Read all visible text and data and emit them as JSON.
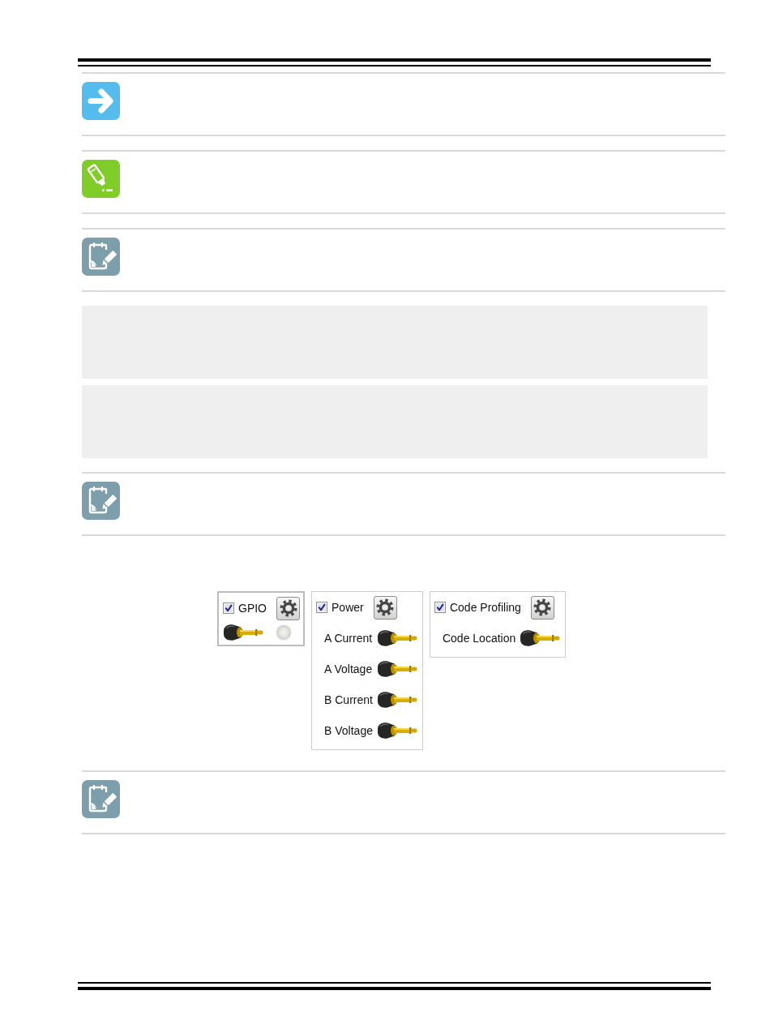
{
  "page": {
    "blocks": [
      {
        "kind": "tip"
      },
      {
        "kind": "important"
      },
      {
        "kind": "note"
      },
      {
        "kind": "code"
      },
      {
        "kind": "code"
      },
      {
        "kind": "note"
      },
      {
        "kind": "figure",
        "panels": [
          {
            "title": "GPIO",
            "checked": true,
            "selected": true,
            "channels": [
              {
                "kind": "probe"
              },
              {
                "kind": "led",
                "on": false
              }
            ]
          },
          {
            "title": "Power",
            "checked": true,
            "selected": false,
            "channels": [
              {
                "kind": "labeled-probe",
                "label": "A Current"
              },
              {
                "kind": "labeled-probe",
                "label": "A Voltage"
              },
              {
                "kind": "labeled-probe",
                "label": "B Current"
              },
              {
                "kind": "labeled-probe",
                "label": "B Voltage"
              }
            ]
          },
          {
            "title": "Code Profiling",
            "checked": true,
            "selected": false,
            "channels": [
              {
                "kind": "labeled-probe",
                "label": "Code Location"
              }
            ]
          }
        ]
      },
      {
        "kind": "note"
      }
    ]
  }
}
